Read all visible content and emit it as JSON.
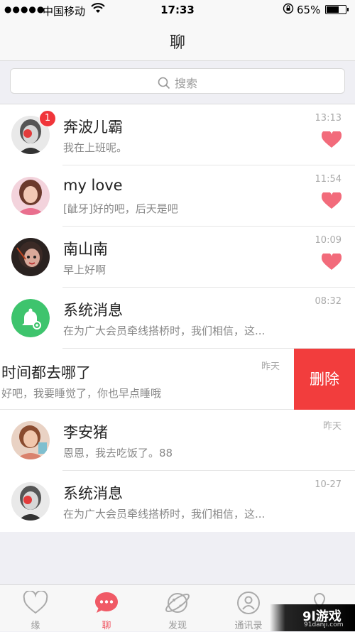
{
  "status_bar": {
    "signal": "●●●●●",
    "carrier": "中国移动",
    "time": "17:33",
    "battery": "65%"
  },
  "nav": {
    "title": "聊"
  },
  "search": {
    "placeholder": "搜索"
  },
  "chats": [
    {
      "name": "奔波儿霸",
      "preview": "我在上班呢。",
      "time": "13:13",
      "badge": "1",
      "favorited": true
    },
    {
      "name": "my love",
      "preview": "[龇牙]好的吧，后天是吧",
      "time": "11:54",
      "favorited": true
    },
    {
      "name": "南山南",
      "preview": "早上好啊",
      "time": "10:09",
      "favorited": true
    },
    {
      "name": "系统消息",
      "preview": "在为广大会员牵线搭桥时，我们相信，这...",
      "time": "08:32",
      "favorited": false
    },
    {
      "name": "时间都去哪了",
      "preview": "好吧，我要睡觉了，你也早点睡哦",
      "time": "昨天",
      "favorited": false,
      "action": "删除"
    },
    {
      "name": "李安猪",
      "preview": "恩恩，我去吃饭了。88",
      "time": "昨天",
      "favorited": false
    },
    {
      "name": "系统消息",
      "preview": "在为广大会员牵线搭桥时，我们相信，这...",
      "time": "10-27",
      "favorited": false
    }
  ],
  "tabs": [
    {
      "label": "缘",
      "icon": "heart-outline-icon"
    },
    {
      "label": "聊",
      "icon": "chat-bubble-icon",
      "active": true
    },
    {
      "label": "发现",
      "icon": "planet-icon"
    },
    {
      "label": "通讯录",
      "icon": "contacts-icon"
    }
  ],
  "watermark": {
    "main": "9l游戏",
    "sub": "91danji.com"
  },
  "colors": {
    "accent": "#f05a66",
    "heart": "#f26b7b",
    "badge": "#f0353a",
    "delete": "#f23d3d",
    "system_icon": "#3ec46d"
  }
}
